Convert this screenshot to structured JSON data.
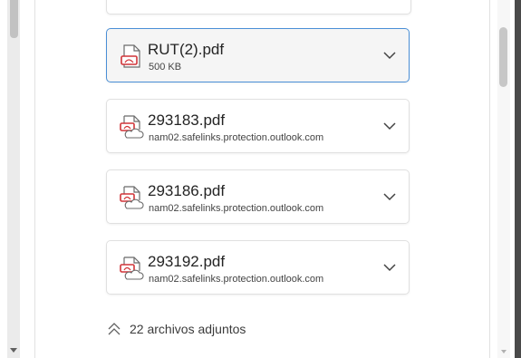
{
  "attachments": [
    {
      "name": "RUT(2).pdf",
      "detail": "500 KB",
      "selected": true
    },
    {
      "name": "293183.pdf",
      "detail": "nam02.safelinks.protection.outlook.com",
      "selected": false
    },
    {
      "name": "293186.pdf",
      "detail": "nam02.safelinks.protection.outlook.com",
      "selected": false
    },
    {
      "name": "293192.pdf",
      "detail": "nam02.safelinks.protection.outlook.com",
      "selected": false
    }
  ],
  "footer": {
    "toggle_label": "22 archivos adjuntos",
    "icon": "double-chevron-up-icon"
  },
  "colors": {
    "accent_border": "#4a8fd6",
    "pdf_icon": "#d13438"
  }
}
